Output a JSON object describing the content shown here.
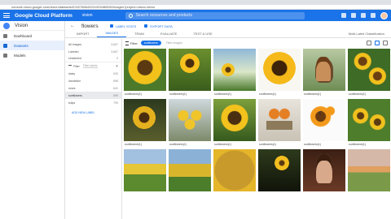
{
  "browser": {
    "url": "console.cloud.google.com/vision/datasets/ICN2786643201925486592/images?project=vision-demo"
  },
  "topbar": {
    "title": "Google Cloud Platform",
    "project": "vision",
    "search_placeholder": "Search resources and products"
  },
  "nav": {
    "product": "Vision",
    "items": [
      {
        "label": "Dashboard"
      },
      {
        "label": "Datasets"
      },
      {
        "label": "Models"
      }
    ]
  },
  "dataset": {
    "back": "←",
    "name": "flowers",
    "actions": [
      "LABEL STATS",
      "EXPORT DATA"
    ]
  },
  "tabs": [
    "IMPORT",
    "IMAGES",
    "TRAIN",
    "EVALUATE",
    "TEST & USE"
  ],
  "classification_type": "Multi-Label Classification",
  "filters": {
    "summary": [
      {
        "label": "All images",
        "count": "3,667"
      },
      {
        "label": "Labeled",
        "count": "3,667"
      },
      {
        "label": "Unlabeled",
        "count": "0"
      }
    ],
    "filter_label": "Filter",
    "filter_input": "Filter labels",
    "labels": [
      {
        "label": "daisy",
        "count": "633"
      },
      {
        "label": "dandelion",
        "count": "898"
      },
      {
        "label": "roses",
        "count": "641"
      },
      {
        "label": "sunflowers",
        "count": "699"
      },
      {
        "label": "tulips",
        "count": "799"
      }
    ],
    "add_label": "ADD NEW LABEL"
  },
  "gallery": {
    "filter_label": "Filter",
    "chip": "sunflowers",
    "filter_images": "Filter images",
    "captions": [
      "sunflowers(1)",
      "sunflowers(1)",
      "sunflowers(1)",
      "sunflowers(1)",
      "sunflowers(1)",
      "sunflowers(1)",
      "sunflowers(1)",
      "sunflowers(1)",
      "sunflowers(1)",
      "sunflowers(1)",
      "sunflowers(1)",
      "sunflowers(1)",
      "",
      "",
      "",
      "",
      "",
      ""
    ]
  }
}
